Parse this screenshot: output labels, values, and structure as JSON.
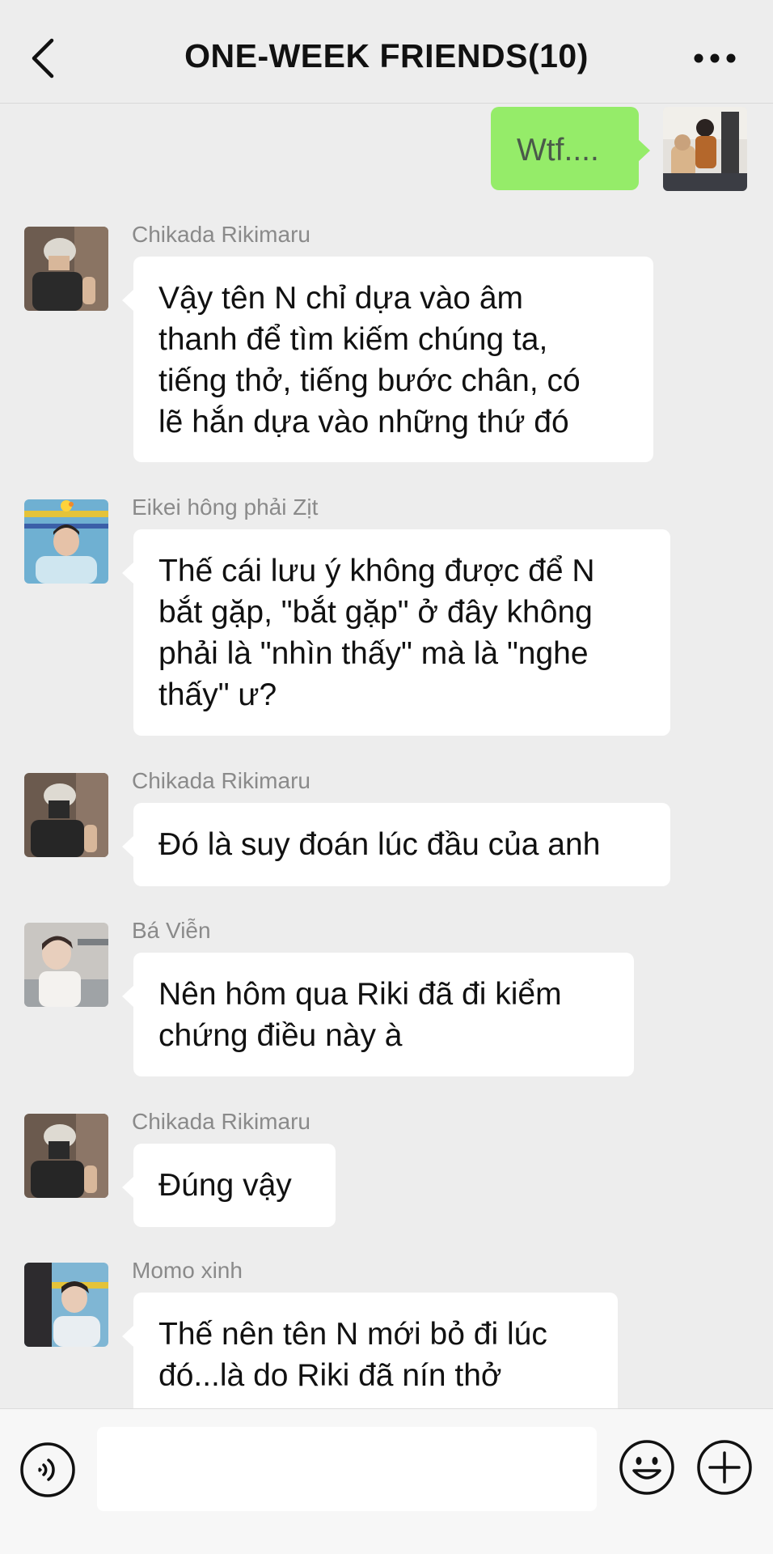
{
  "header": {
    "title": "ONE-WEEK FRIENDS(10)",
    "back_icon": "chevron-left-icon",
    "more_icon": "more-dots-icon"
  },
  "messages": [
    {
      "sender": "",
      "text": "Wtf....",
      "mine": true
    },
    {
      "sender": "Chikada Rikimaru",
      "text": "Vậy tên N chỉ dựa vào âm\nthanh để tìm kiếm chúng ta,\ntiếng thở, tiếng bước chân, có\nlẽ hắn dựa vào những thứ đó"
    },
    {
      "sender": "Eikei hông phải Zịt",
      "text": "Thế cái lưu ý không được để N\nbắt gặp, \"bắt gặp\" ở đây không\nphải là \"nhìn thấy\" mà là \"nghe\nthấy\" ư?"
    },
    {
      "sender": "Chikada Rikimaru",
      "text": "Đó là suy đoán lúc đầu của anh"
    },
    {
      "sender": "Bá Viễn",
      "text": "Nên hôm qua Riki đã đi kiểm\nchứng điều này à"
    },
    {
      "sender": "Chikada Rikimaru",
      "text": "Đúng vậy"
    },
    {
      "sender": "Momo xinh",
      "text": "Thế nên tên N mới bỏ đi lúc\nđó...là do Riki đã nín thở"
    }
  ],
  "input_bar": {
    "voice_icon": "voice-icon",
    "emoji_icon": "emoji-icon",
    "plus_icon": "plus-icon",
    "input_value": ""
  },
  "colors": {
    "background": "#ededed",
    "my_bubble": "#95ec69",
    "other_bubble": "#ffffff",
    "sender_name": "#8a8a8a"
  }
}
